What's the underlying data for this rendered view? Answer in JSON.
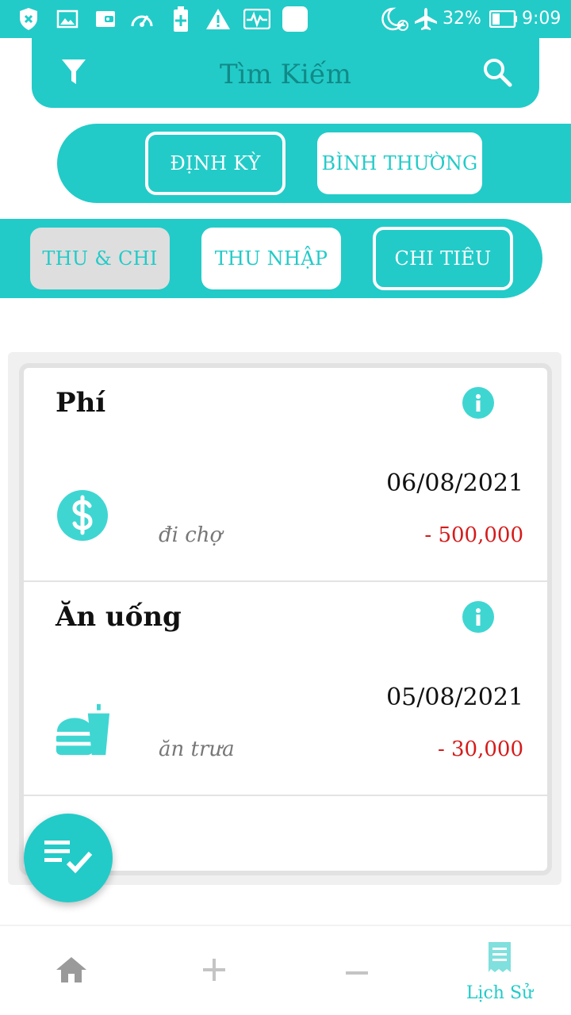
{
  "status_bar": {
    "battery": "32%",
    "time": "9:09",
    "icons": [
      "shield-icon",
      "image-icon",
      "wallet-icon",
      "gauge-icon",
      "battery-saver-icon",
      "warning-icon",
      "activity-icon",
      "app-icon",
      "do-not-disturb-icon",
      "airplane-icon",
      "battery-icon"
    ]
  },
  "header": {
    "title": "Tìm Kiếm",
    "filter_icon": "filter-icon",
    "search_icon": "search-icon"
  },
  "schedule_tabs": {
    "periodic": "ĐỊNH KỲ",
    "normal": "BÌNH THƯỜNG",
    "selected": "periodic"
  },
  "type_tabs": {
    "all": "THU & CHI",
    "income": "THU NHẬP",
    "expense": "CHI TIÊU",
    "selected": "expense"
  },
  "entries": [
    {
      "category": "Phí",
      "icon": "dollar-icon",
      "date": "06/08/2021",
      "note": "đi chợ",
      "amount": "- 500,000"
    },
    {
      "category": "Ăn uống",
      "icon": "fast-food-icon",
      "date": "05/08/2021",
      "note": "ăn trưa",
      "amount": "- 30,000"
    }
  ],
  "bottom_nav": {
    "history_label": "Lịch Sử",
    "active": "history"
  },
  "colors": {
    "accent": "#22cbc8",
    "header_text": "#118a87",
    "negative": "#d61a1a"
  }
}
